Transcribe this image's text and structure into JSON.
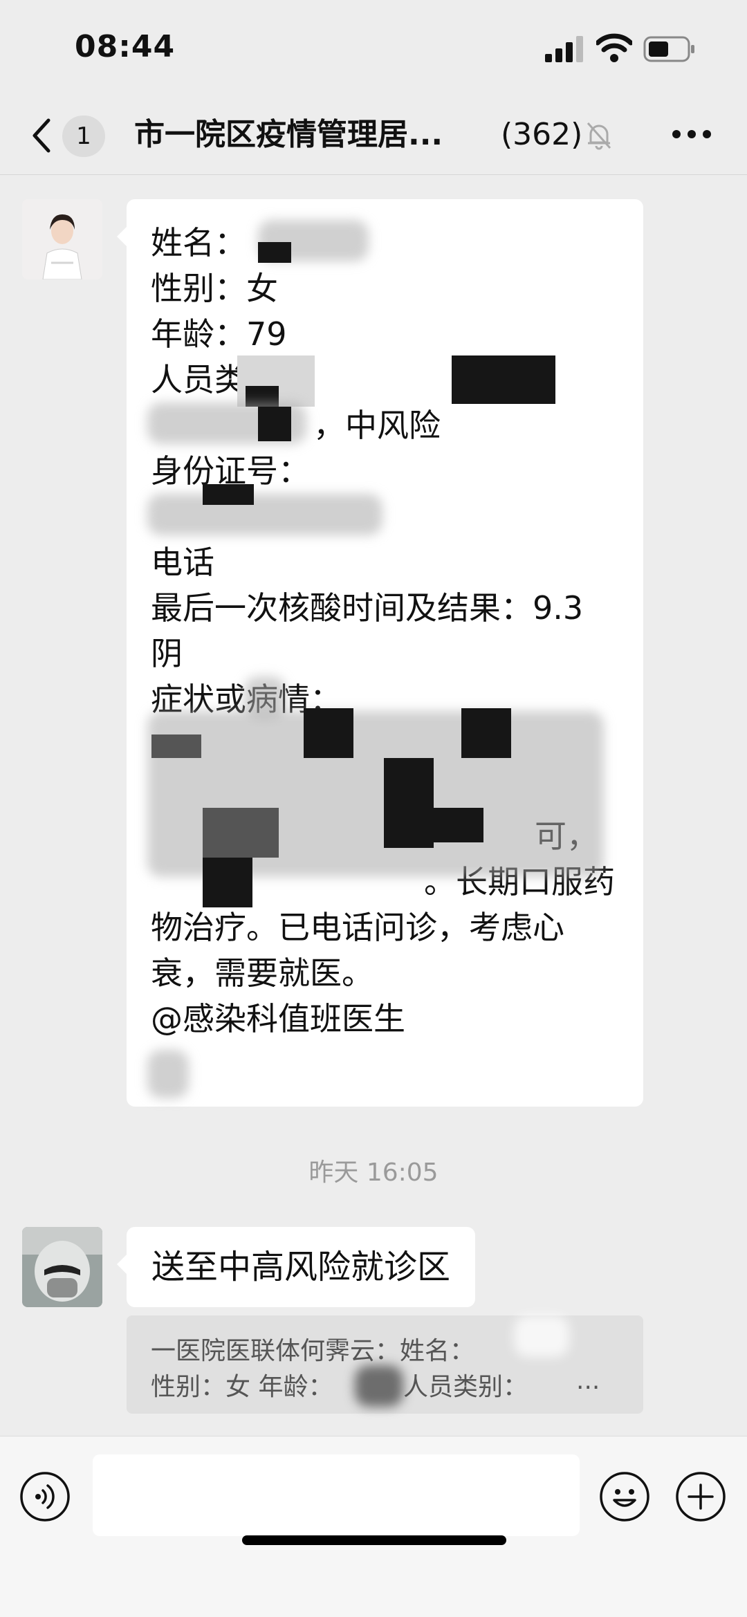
{
  "status_bar": {
    "time": "08:44"
  },
  "nav": {
    "unread_count": "1",
    "title": "市一院区疫情管理居...",
    "member_count": "(362)"
  },
  "messages": {
    "first": {
      "lines": [
        "姓名：",
        "性别：女",
        "年龄：79",
        "人员类别：",
        "，中风险",
        "身份证号：",
        "电话",
        "最后一次核酸时间及结果：9.3",
        "阴",
        "症状或病情：",
        "可，",
        "。长期口服药",
        "物治疗。已电话问诊，考虑心",
        "衰，需要就医。",
        "@感染科值班医生"
      ]
    },
    "timestamp": "昨天 16:05",
    "second": {
      "text": "送至中高风险就诊区"
    },
    "quote": {
      "line1": "一医院医联体何霁云：姓名：",
      "line2": "性别：女 年龄：",
      "line2b": "人员类别：",
      "ellipsis": "..."
    }
  }
}
